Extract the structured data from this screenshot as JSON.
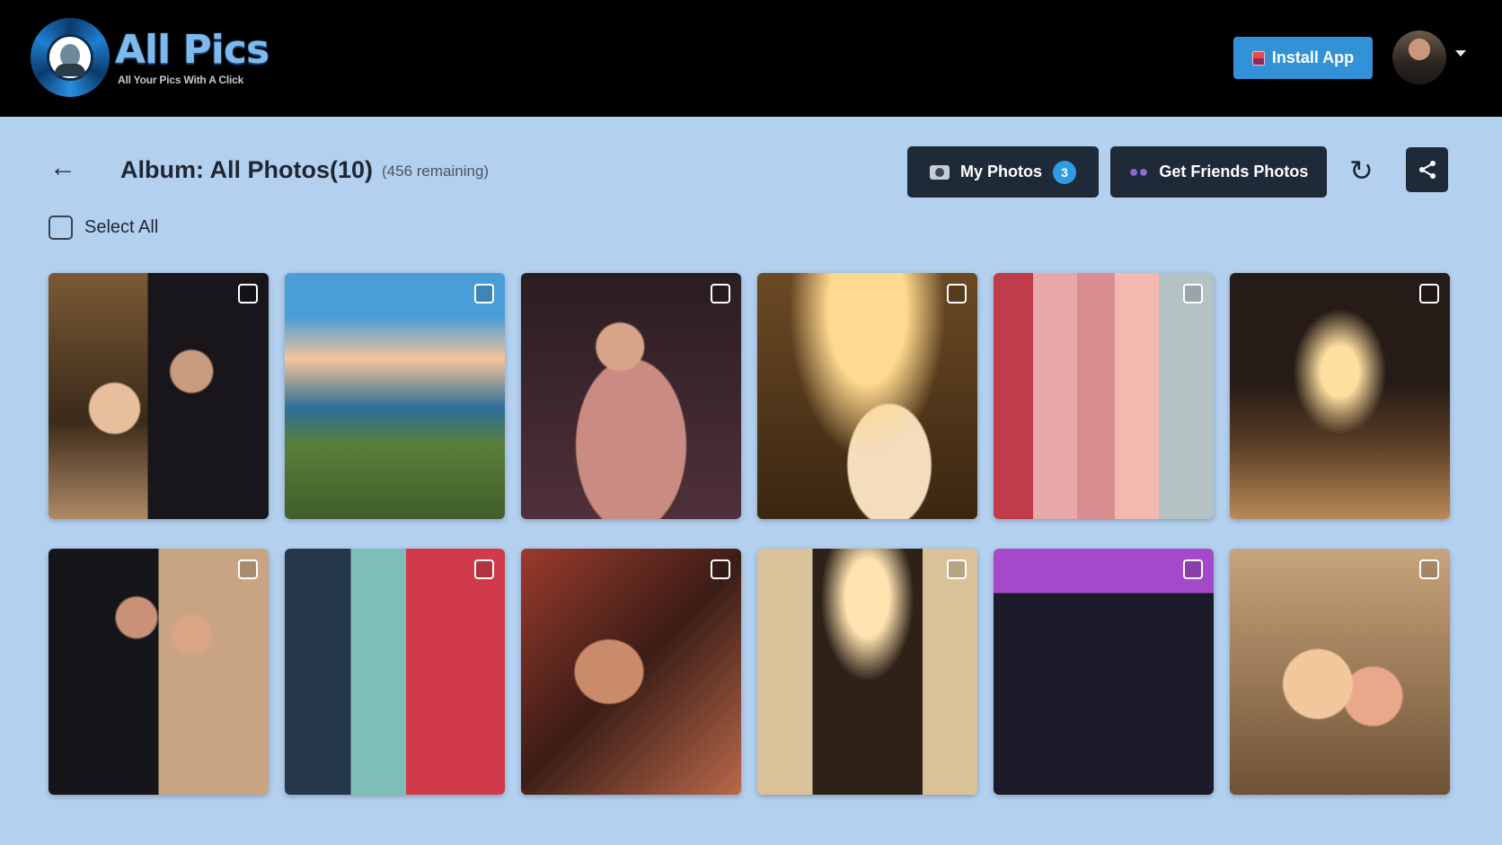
{
  "header": {
    "logo_title": "All Pics",
    "logo_tagline": "All Your Pics With A Click",
    "install_label": "Install App"
  },
  "album": {
    "back_icon": "←",
    "title": "Album: All Photos(10)",
    "remaining": "(456 remaining)"
  },
  "toolbar": {
    "my_photos_label": "My Photos",
    "my_photos_count": "3",
    "friends_label": "Get Friends Photos",
    "refresh_icon": "↻",
    "share_icon": "share-icon"
  },
  "select_all_label": "Select All",
  "photos": [
    {
      "alt": "couple-embrace-lights"
    },
    {
      "alt": "beach-mandap"
    },
    {
      "alt": "bride-portrait"
    },
    {
      "alt": "reception-tent"
    },
    {
      "alt": "bridesmaids-group"
    },
    {
      "alt": "aisle-lights"
    },
    {
      "alt": "couple-portrait"
    },
    {
      "alt": "dance-party"
    },
    {
      "alt": "hands-ceremony"
    },
    {
      "alt": "chandelier-aisle"
    },
    {
      "alt": "groomsmen-group"
    },
    {
      "alt": "floral-centerpiece"
    }
  ]
}
